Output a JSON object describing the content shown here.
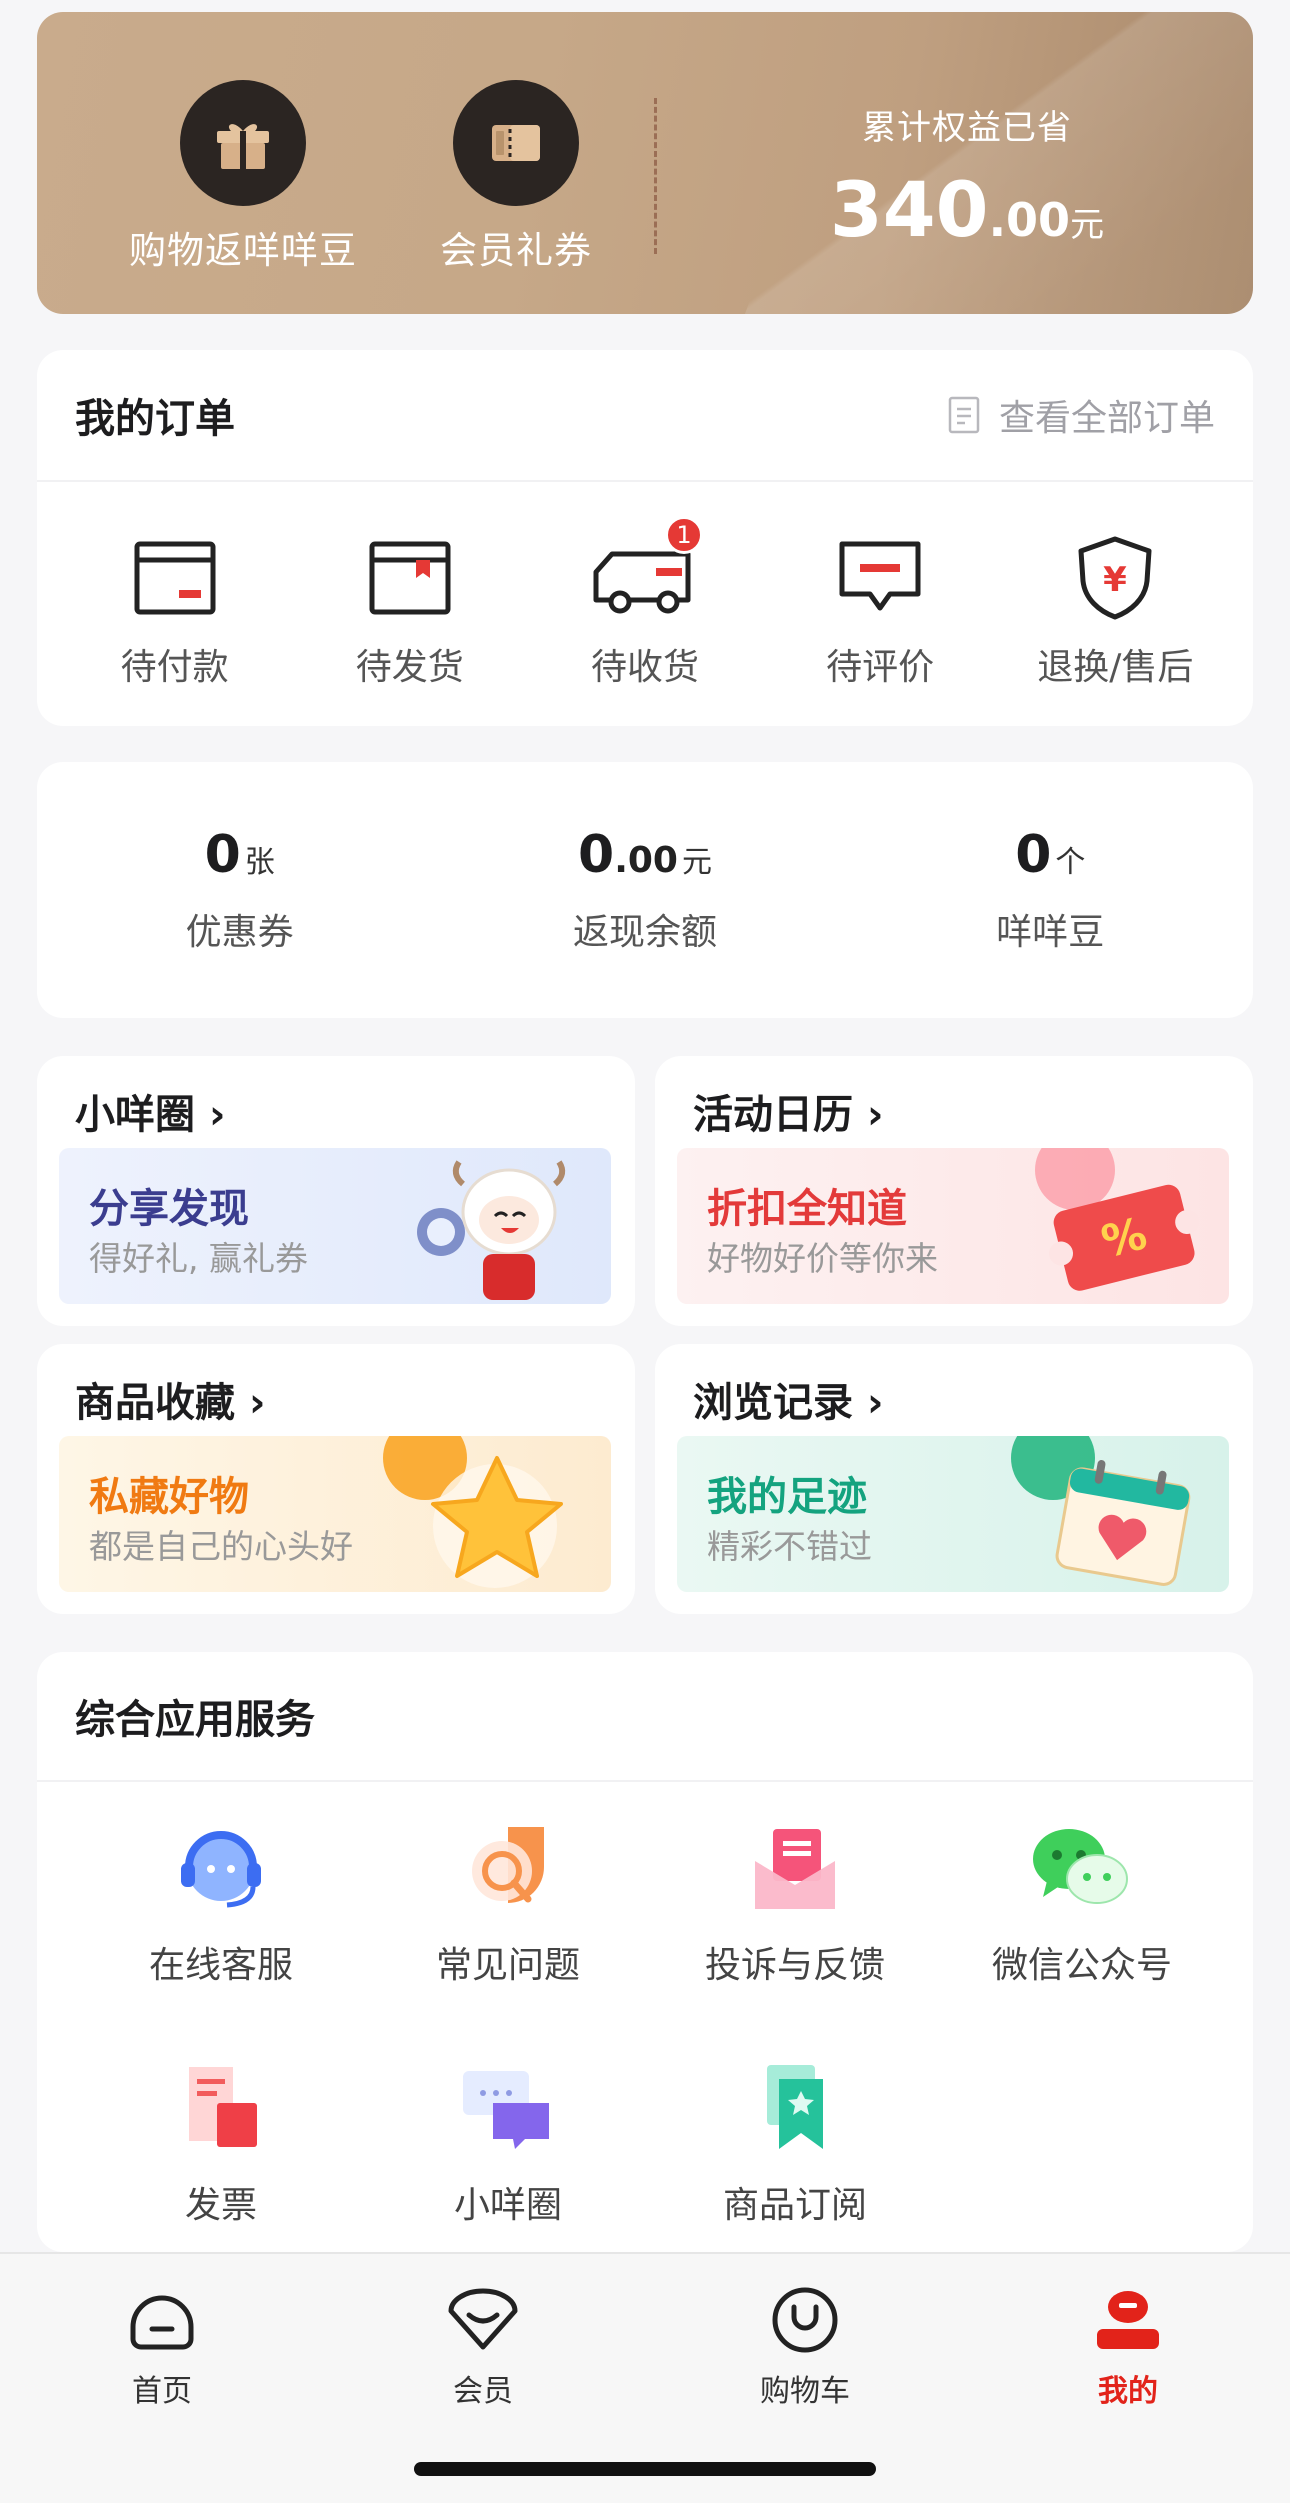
{
  "banner": {
    "benefits": [
      {
        "label": "购物返咩咩豆",
        "icon": "gift-icon"
      },
      {
        "label": "会员礼券",
        "icon": "ticket-icon"
      }
    ],
    "saved_title": "累计权益已省",
    "saved_int": "340",
    "saved_dec": ".00",
    "saved_unit": "元"
  },
  "orders": {
    "title": "我的订单",
    "view_all": "查看全部订单",
    "items": [
      {
        "label": "待付款",
        "icon": "wallet-icon"
      },
      {
        "label": "待发货",
        "icon": "package-icon"
      },
      {
        "label": "待收货",
        "icon": "truck-icon",
        "badge": "1"
      },
      {
        "label": "待评价",
        "icon": "comment-icon"
      },
      {
        "label": "退换/售后",
        "icon": "shield-yen-icon"
      }
    ]
  },
  "stats": [
    {
      "num": "0",
      "dec": "",
      "unit": "张",
      "name": "优惠券"
    },
    {
      "num": "0",
      "dec": ".00",
      "unit": "元",
      "name": "返现余额"
    },
    {
      "num": "0",
      "dec": "",
      "unit": "个",
      "name": "咩咩豆"
    }
  ],
  "tiles": [
    {
      "title": "小咩圈",
      "heading": "分享发现",
      "sub": "得好礼, 赢礼券",
      "heading_color": "#3b3d8f",
      "bg": "#e9effd"
    },
    {
      "title": "活动日历",
      "heading": "折扣全知道",
      "sub": "好物好价等你来",
      "heading_color": "#e33a3a",
      "bg": "#fdeeee"
    },
    {
      "title": "商品收藏",
      "heading": "私藏好物",
      "sub": "都是自己的心头好",
      "heading_color": "#f07a12",
      "bg": "#fdf3e2"
    },
    {
      "title": "浏览记录",
      "heading": "我的足迹",
      "sub": "精彩不错过",
      "heading_color": "#14a37f",
      "bg": "#e4f7f1"
    }
  ],
  "services": {
    "title": "综合应用服务",
    "items": [
      {
        "label": "在线客服",
        "icon": "headset-icon"
      },
      {
        "label": "常见问题",
        "icon": "faq-icon"
      },
      {
        "label": "投诉与反馈",
        "icon": "feedback-icon"
      },
      {
        "label": "微信公众号",
        "icon": "wechat-icon"
      },
      {
        "label": "发票",
        "icon": "invoice-icon"
      },
      {
        "label": "小咩圈",
        "icon": "chat-bubbles-icon"
      },
      {
        "label": "商品订阅",
        "icon": "bookmark-icon"
      }
    ]
  },
  "nav": [
    {
      "label": "首页",
      "icon": "home-icon"
    },
    {
      "label": "会员",
      "icon": "member-icon"
    },
    {
      "label": "购物车",
      "icon": "cart-icon"
    },
    {
      "label": "我的",
      "icon": "profile-icon",
      "active": true
    }
  ],
  "colors": {
    "accent": "#e2231a",
    "banner": "#c6a888"
  }
}
